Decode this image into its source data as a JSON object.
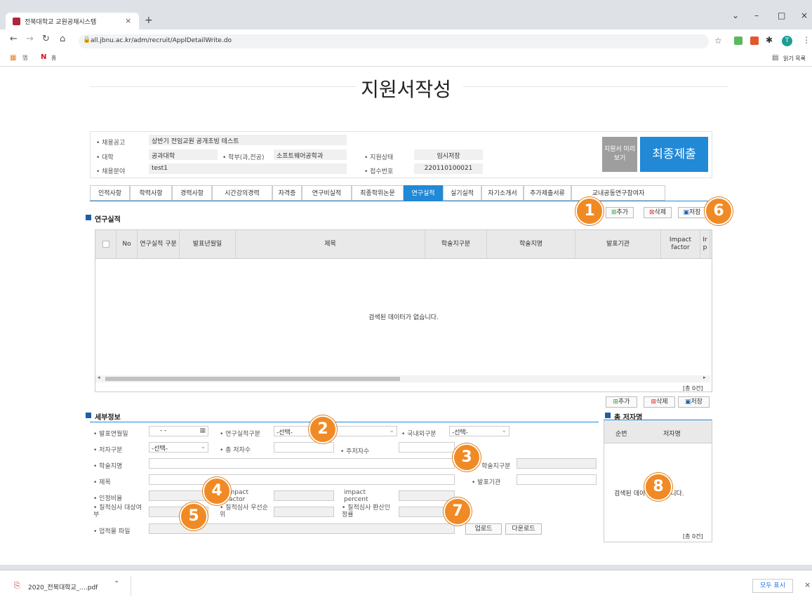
{
  "browser": {
    "tab_title": "전북대학교 교원공채시스템",
    "tab_close": "×",
    "new_tab": "+",
    "url": "all.jbnu.ac.kr/adm/recruit/ApplDetailWrite.do",
    "reading_list": "읽기 목록",
    "profile_initial": "T"
  },
  "page": {
    "title": "지원서작성"
  },
  "info": {
    "notice_label": "• 채용공고",
    "notice_value": "상반기 전임교원 공개초빙 테스트",
    "college_label": "• 대학",
    "college_value": "공과대학",
    "dept_label": "• 학부(과,전공)",
    "dept_value": "소프트웨어공학과",
    "field_label": "• 채용분야",
    "field_value": "test1",
    "status_label": "• 지원상태",
    "status_value": "임시저장",
    "receipt_label": "• 접수번호",
    "receipt_value": "220110100021",
    "preview_button": "지원서 미리보기",
    "final_submit_button": "최종제출"
  },
  "tabs": [
    {
      "label": "인적사항"
    },
    {
      "label": "학력사항"
    },
    {
      "label": "경력사항"
    },
    {
      "label": "시간강의경력"
    },
    {
      "label": "자격증"
    },
    {
      "label": "연구비실적"
    },
    {
      "label": "최종학위논문"
    },
    {
      "label": "연구실적"
    },
    {
      "label": "실기실적"
    },
    {
      "label": "자기소개서"
    },
    {
      "label": "추가제출서류"
    },
    {
      "label": "교내공동연구참여자"
    }
  ],
  "research": {
    "section_title": "연구실적",
    "add_button": "추가",
    "delete_button": "삭제",
    "save_button": "저장",
    "columns": [
      "No",
      "연구실적 구분",
      "발표년월일",
      "제목",
      "학술지구분",
      "학술지명",
      "발표기관",
      "Impact factor",
      "Ir p"
    ],
    "empty_message": "검색된 데이터가 없습니다.",
    "total": "[총 0건]"
  },
  "detail": {
    "section_title": "세부정보",
    "pub_date_label": "• 발표연월일",
    "pub_date_value": "- -",
    "category_label": "• 연구실적구분",
    "category_value": "-선택-",
    "domestic_label": "• 국내외구분",
    "domestic_value": "-선택-",
    "author_type_label": "• 저자구분",
    "author_type_value": "-선택-",
    "total_authors_label": "• 총 저자수",
    "main_authors_label": "• 주저자수",
    "journal_type_label": "학술지구분",
    "journal_name_label": "• 학술지명",
    "pub_org_label": "• 발표기관",
    "title_label": "• 제목",
    "ratio_label": "• 인정비율",
    "impact_factor_label": "impact factor",
    "impact_percent_label": "impact percent",
    "review_target_label": "• 질적심사 대상여부",
    "review_priority_label": "• 질적심사 우선순위",
    "review_ratio_label": "• 질적심사 환산인정률",
    "file_label": "• 업적물 파일",
    "upload_button": "업로드",
    "download_button": "다운로드"
  },
  "authors": {
    "section_title": "총 저자명",
    "add_button": "추가",
    "delete_button": "삭제",
    "save_button": "저장",
    "col_order": "순번",
    "col_name": "저자명",
    "empty_message": "검색된 데이터가 없습니다.",
    "total": "[총 0건]"
  },
  "badges": [
    "1",
    "2",
    "3",
    "4",
    "5",
    "6",
    "7",
    "8"
  ],
  "download": {
    "file_name": "2020_전북대학교_....pdf",
    "show_all": "모두 표시"
  },
  "colors": {
    "accent": "#2189d6",
    "badge": "#f08a24"
  }
}
